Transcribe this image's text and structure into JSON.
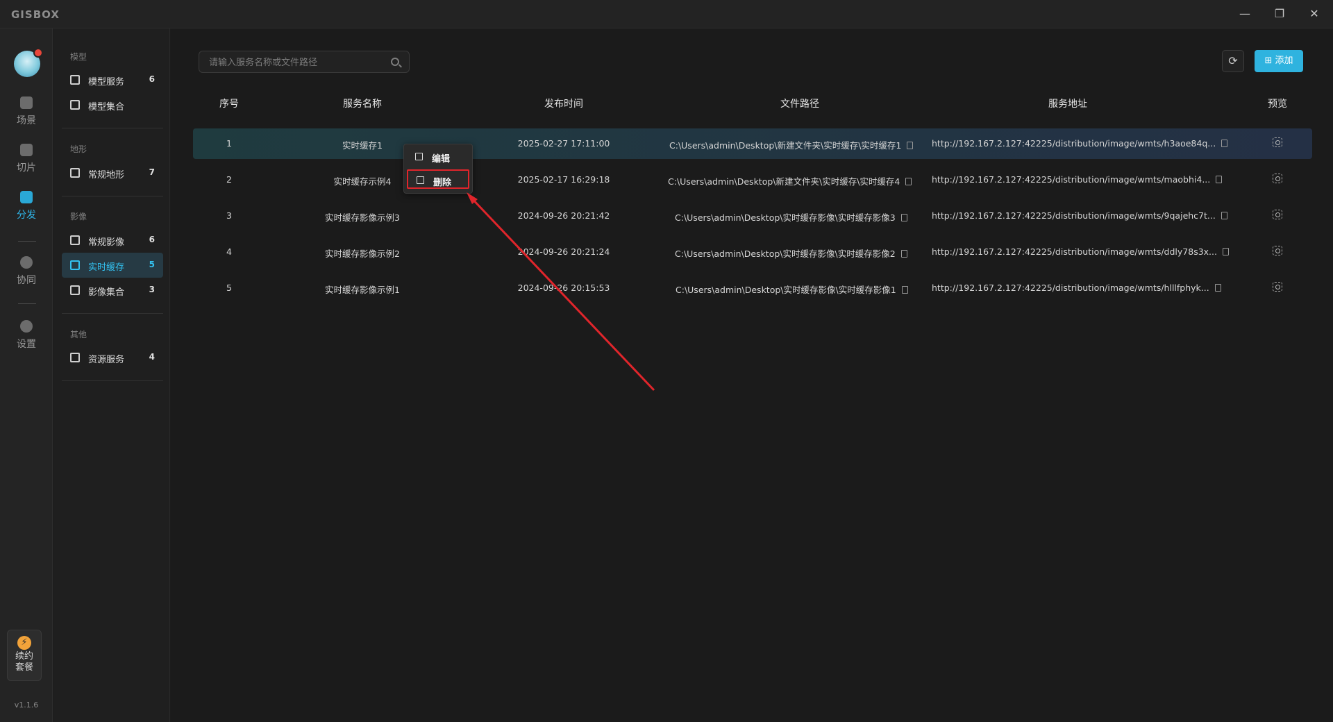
{
  "app": {
    "logo": "GISBOX"
  },
  "window_controls": {
    "minimize": "—",
    "maximize": "❐",
    "close": "✕"
  },
  "rail": {
    "items": [
      {
        "label": "场景",
        "icon": "home-icon"
      },
      {
        "label": "切片",
        "icon": "slice-icon"
      },
      {
        "label": "分发",
        "icon": "distribute-icon"
      },
      {
        "label": "协同",
        "icon": "lock-icon"
      },
      {
        "label": "设置",
        "icon": "settings-icon"
      }
    ],
    "renew": {
      "line1": "续约",
      "line2": "套餐",
      "icon": "⚡"
    },
    "version": "v1.1.6"
  },
  "sidebar": {
    "groups": [
      {
        "title": "模型",
        "items": [
          {
            "label": "模型服务",
            "count": "6"
          },
          {
            "label": "模型集合",
            "count": ""
          }
        ]
      },
      {
        "title": "地形",
        "items": [
          {
            "label": "常规地形",
            "count": "7"
          }
        ]
      },
      {
        "title": "影像",
        "items": [
          {
            "label": "常规影像",
            "count": "6"
          },
          {
            "label": "实时缓存",
            "count": "5"
          },
          {
            "label": "影像集合",
            "count": "3"
          }
        ]
      },
      {
        "title": "其他",
        "items": [
          {
            "label": "资源服务",
            "count": "4"
          }
        ]
      }
    ]
  },
  "toolbar": {
    "search_placeholder": "请输入服务名称或文件路径",
    "refresh_icon": "⟳",
    "add_label": "添加",
    "add_icon": "⊞"
  },
  "table": {
    "columns": [
      "序号",
      "服务名称",
      "发布时间",
      "文件路径",
      "服务地址",
      "预览"
    ],
    "rows": [
      {
        "index": "1",
        "name": "实时缓存1",
        "time": "2025-02-27 17:11:00",
        "path": "C:\\Users\\admin\\Desktop\\新建文件夹\\实时缓存\\实时缓存1",
        "url": "http://192.167.2.127:42225/distribution/image/wmts/h3aoe84q..."
      },
      {
        "index": "2",
        "name": "实时缓存示例4",
        "time": "2025-02-17 16:29:18",
        "path": "C:\\Users\\admin\\Desktop\\新建文件夹\\实时缓存\\实时缓存4",
        "url": "http://192.167.2.127:42225/distribution/image/wmts/maobhi4..."
      },
      {
        "index": "3",
        "name": "实时缓存影像示例3",
        "time": "2024-09-26 20:21:42",
        "path": "C:\\Users\\admin\\Desktop\\实时缓存影像\\实时缓存影像3",
        "url": "http://192.167.2.127:42225/distribution/image/wmts/9qajehc7t..."
      },
      {
        "index": "4",
        "name": "实时缓存影像示例2",
        "time": "2024-09-26 20:21:24",
        "path": "C:\\Users\\admin\\Desktop\\实时缓存影像\\实时缓存影像2",
        "url": "http://192.167.2.127:42225/distribution/image/wmts/ddly78s3x..."
      },
      {
        "index": "5",
        "name": "实时缓存影像示例1",
        "time": "2024-09-26 20:15:53",
        "path": "C:\\Users\\admin\\Desktop\\实时缓存影像\\实时缓存影像1",
        "url": "http://192.167.2.127:42225/distribution/image/wmts/hlllfphyk..."
      }
    ]
  },
  "context_menu": {
    "edit_label": "编辑",
    "delete_label": "删除"
  },
  "colors": {
    "accent": "#2fb3df",
    "annotation": "#e0252b"
  }
}
